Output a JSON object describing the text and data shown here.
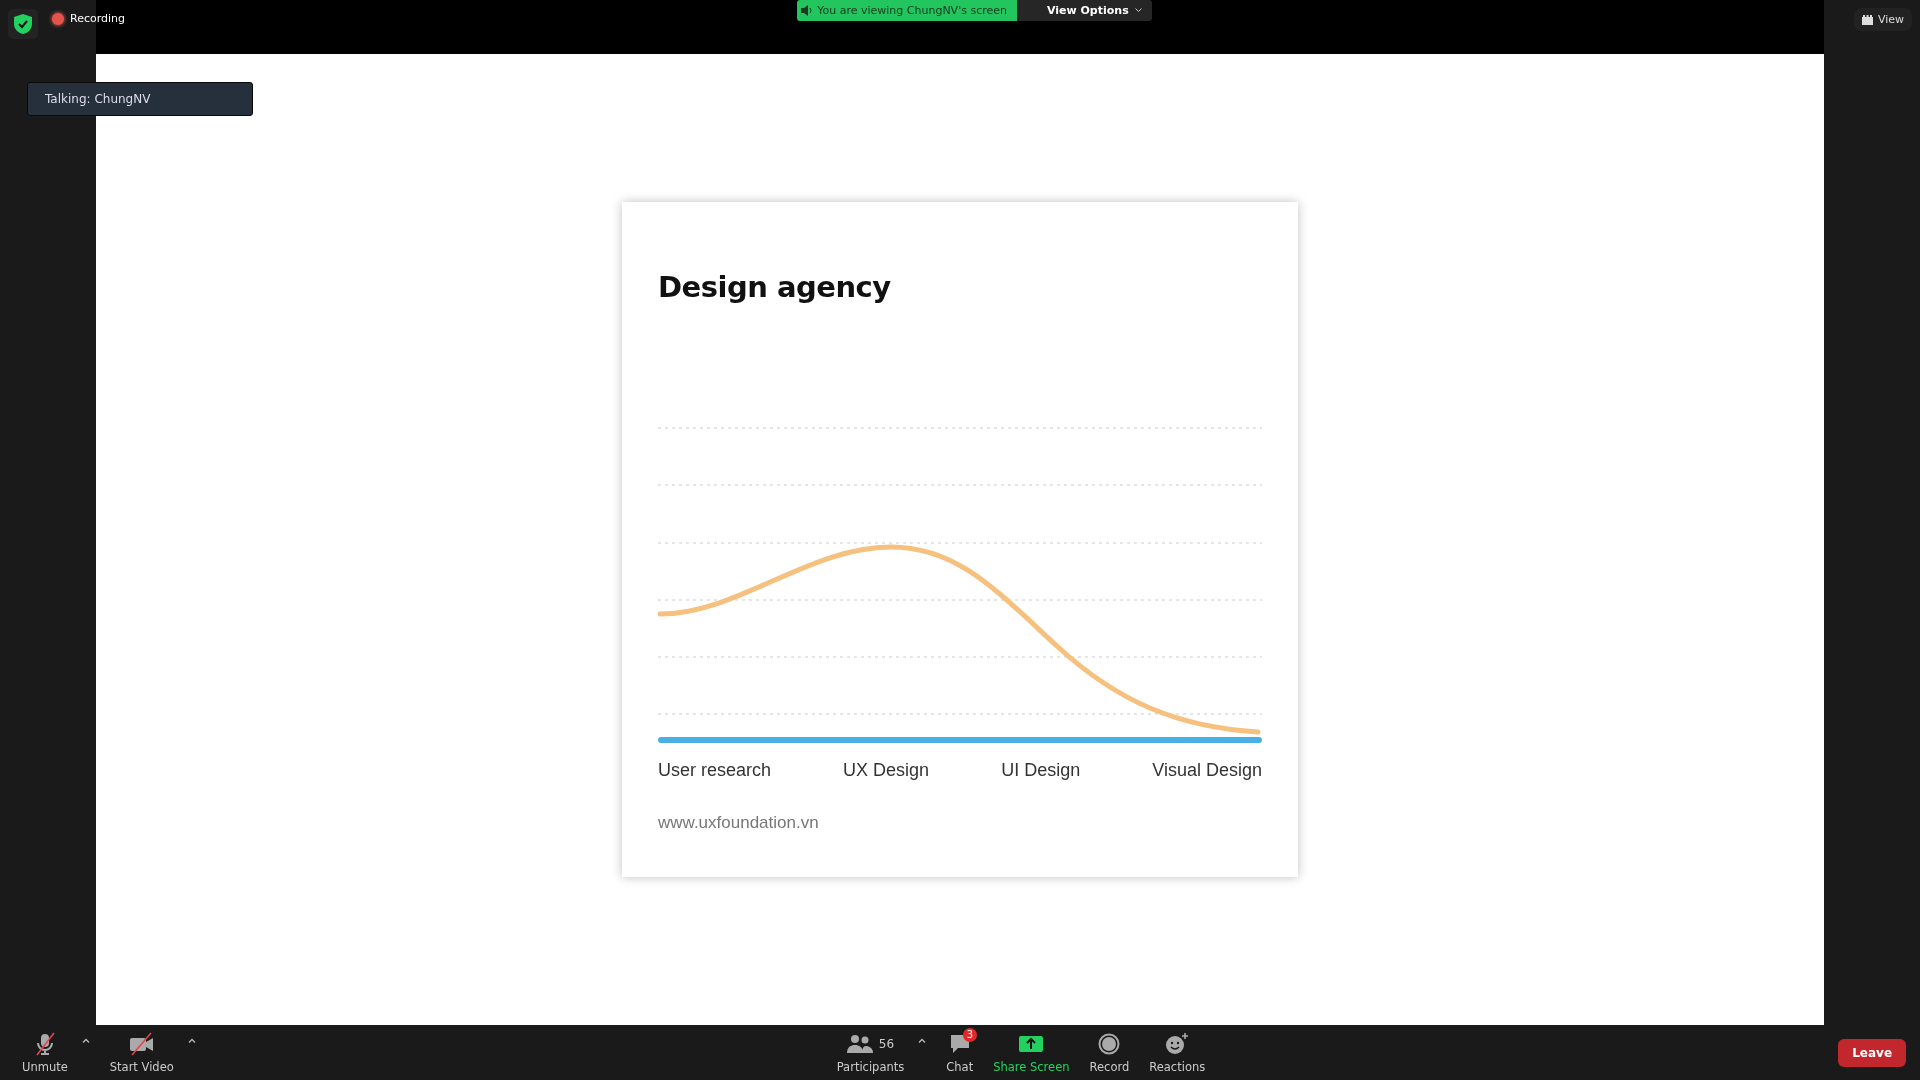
{
  "top_bar": {
    "recording": "Recording",
    "viewing_banner": "You are viewing ChungNV's screen",
    "view_options": "View Options",
    "view_button": "View"
  },
  "talking_indicator": "Talking: ChungNV",
  "slide": {
    "title": "Design agency",
    "stages": [
      "User research",
      "UX Design",
      "UI Design",
      "Visual Design"
    ],
    "url": "www.uxfoundation.vn"
  },
  "toolbar": {
    "left": [
      {
        "kind": "mic",
        "label": "Unmute",
        "menu": true
      },
      {
        "kind": "video",
        "label": "Start Video",
        "menu": true
      }
    ],
    "center": [
      {
        "kind": "participants",
        "label": "Participants",
        "count": "56",
        "menu": true
      },
      {
        "kind": "chat",
        "label": "Chat",
        "badge": "3",
        "menu": false
      },
      {
        "kind": "share",
        "label": "Share Screen",
        "menu": false
      },
      {
        "kind": "record",
        "label": "Record",
        "menu": false
      },
      {
        "kind": "reactions",
        "label": "Reactions",
        "menu": false
      }
    ],
    "leave": "Leave"
  }
}
